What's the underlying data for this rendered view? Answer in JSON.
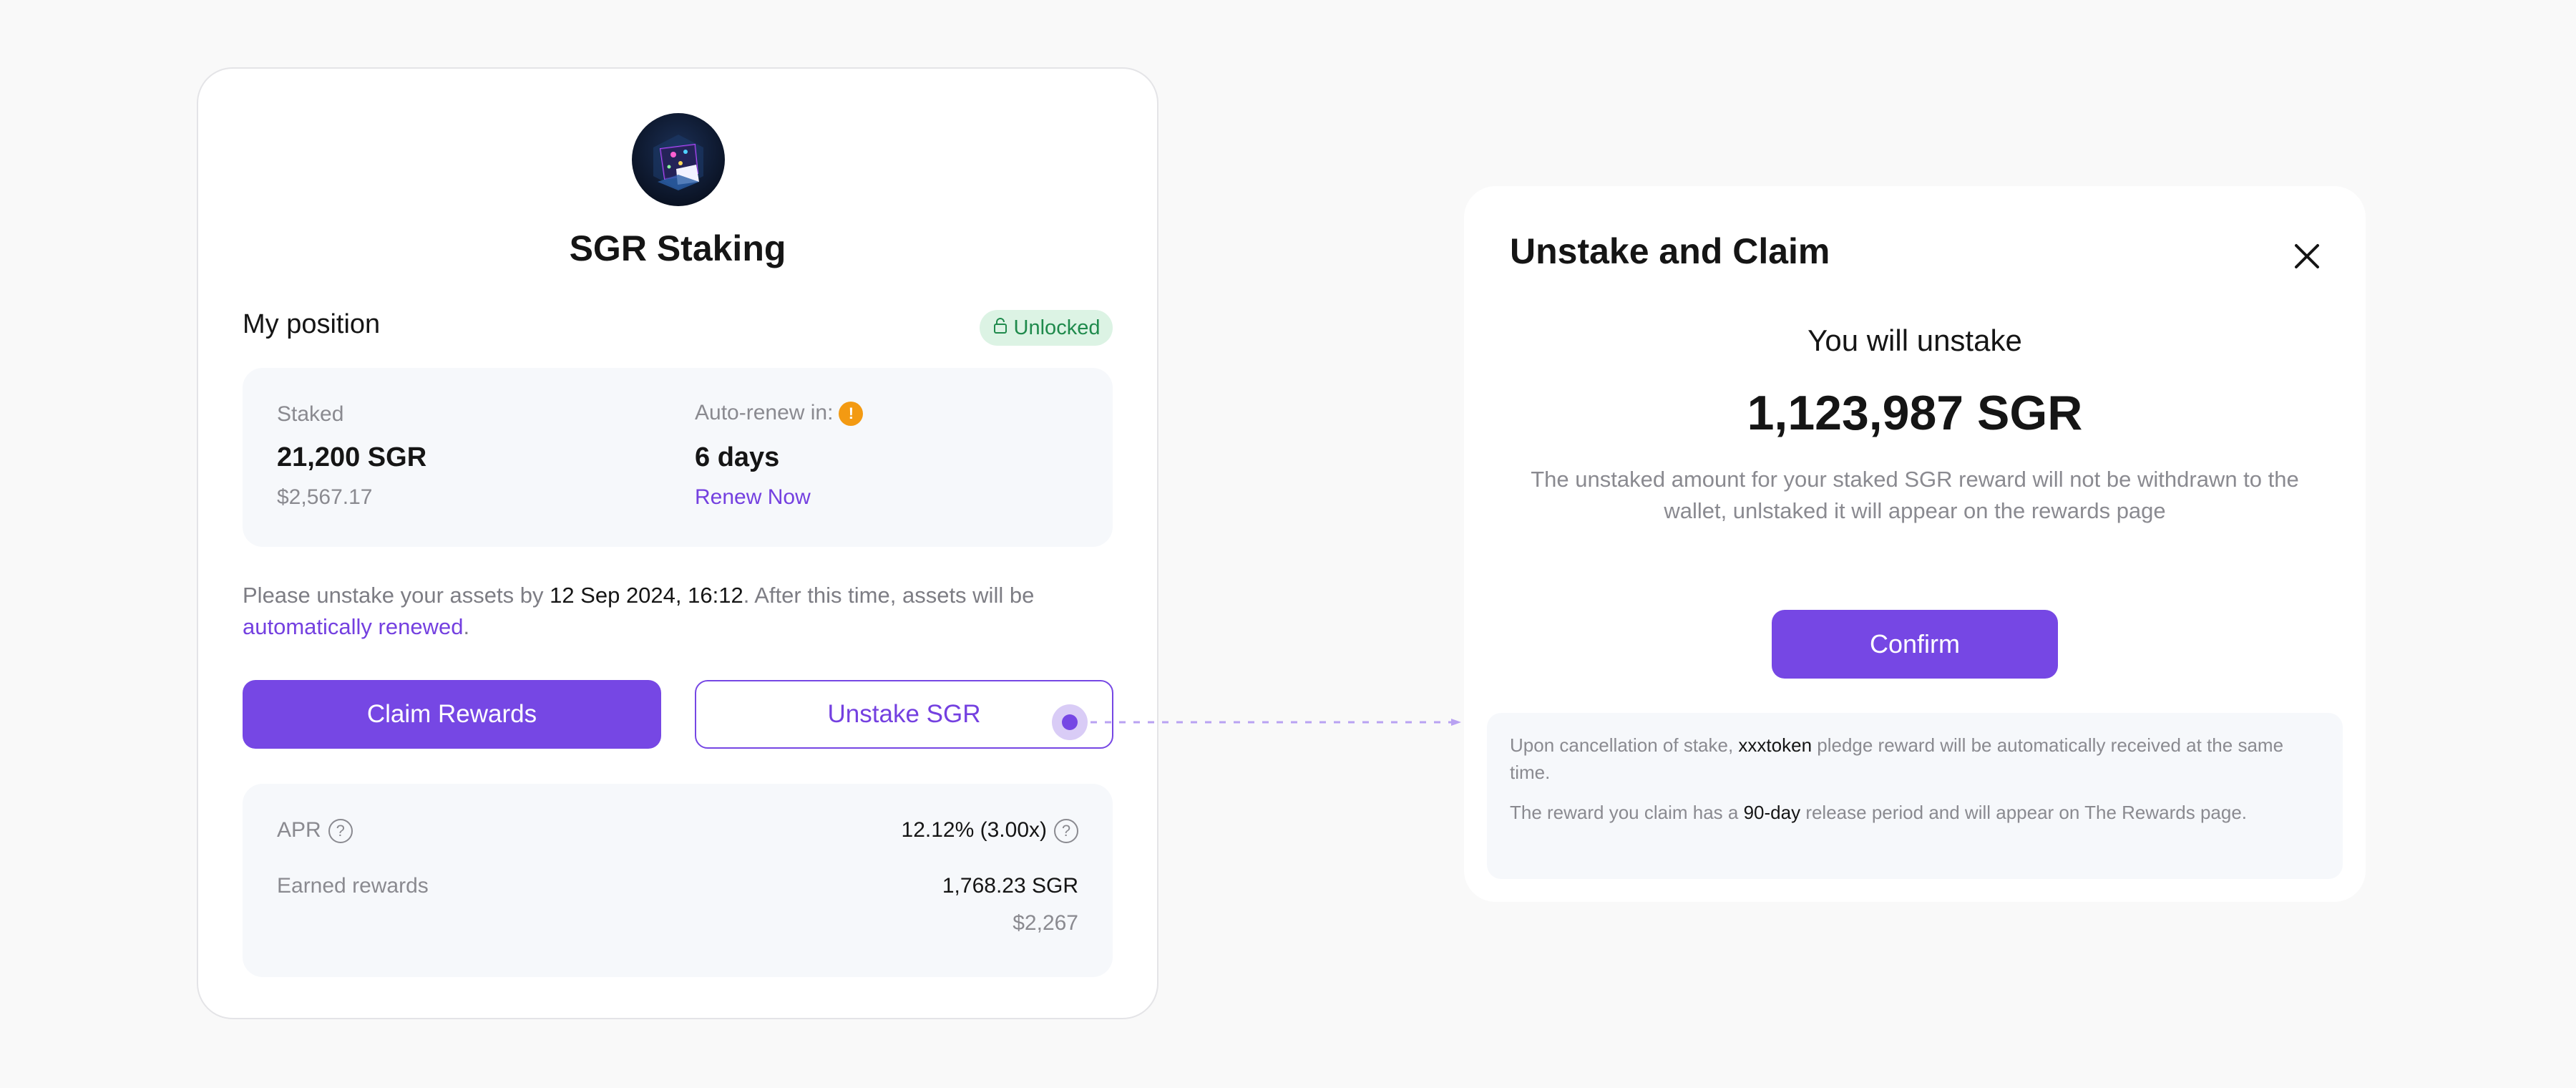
{
  "staking_card": {
    "title": "SGR Staking",
    "section_label": "My position",
    "status_badge": "Unlocked",
    "position": {
      "staked_label": "Staked",
      "staked_amount": "21,200 SGR",
      "staked_usd": "$2,567.17",
      "autorenew_label": "Auto-renew in:",
      "autorenew_value": "6 days",
      "renew_link": "Renew Now"
    },
    "notice": {
      "prefix": "Please unstake your assets by ",
      "deadline": "12 Sep 2024, 16:12",
      "middle": ". After this time, assets will be ",
      "link": "automatically renewed",
      "suffix": "."
    },
    "claim_button": "Claim Rewards",
    "unstake_button": "Unstake SGR",
    "stats": {
      "apr_label": "APR",
      "apr_value": "12.12% (3.00x)",
      "earned_label": "Earned rewards",
      "earned_value": "1,768.23 SGR",
      "earned_usd": "$2,267"
    }
  },
  "modal": {
    "title": "Unstake and Claim",
    "subtitle": "You will unstake",
    "amount": "1,123,987 SGR",
    "description": "The unstaked amount for your staked SGR reward will not be withdrawn to the wallet, unlstaked it will appear on the rewards page",
    "confirm_button": "Confirm",
    "note1": {
      "prefix": "Upon cancellation of stake, ",
      "token": "xxxtoken",
      "suffix": " pledge reward will be automatically received at the same time."
    },
    "note2": {
      "prefix": "The reward you claim has a ",
      "period": "90-day",
      "suffix": " release period and will appear on The Rewards page."
    }
  },
  "colors": {
    "accent": "#7647e4",
    "badge_bg": "#dcf3e4",
    "badge_text": "#1f8a4c",
    "warning": "#f39a12"
  },
  "icons": [
    "lock-icon",
    "info-icon",
    "help-icon",
    "close-icon",
    "token-logo"
  ]
}
